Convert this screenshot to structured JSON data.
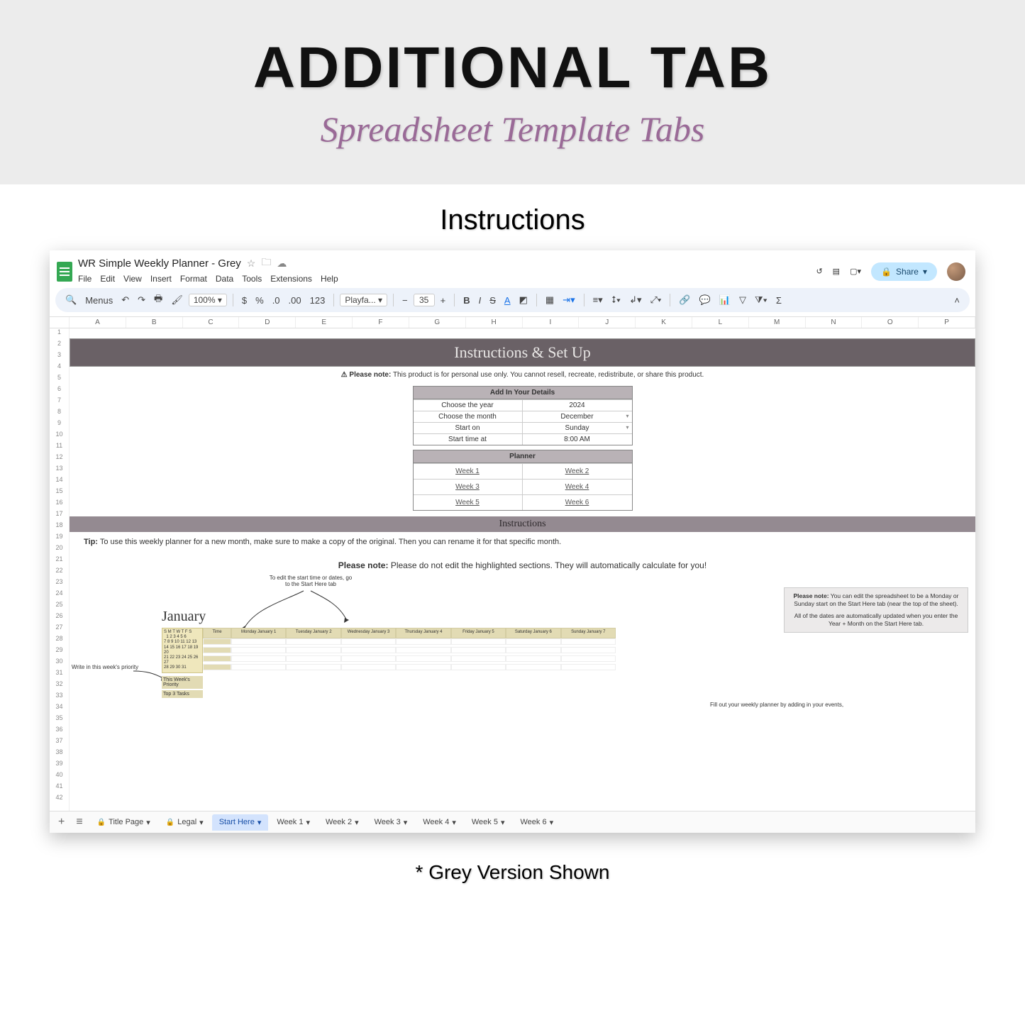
{
  "hero": {
    "title": "ADDITIONAL TAB",
    "subtitle": "Spreadsheet Template Tabs"
  },
  "section_label": "Instructions",
  "caption": "* Grey Version Shown",
  "doc": {
    "title": "WR Simple Weekly Planner - Grey",
    "menus": [
      "File",
      "Edit",
      "View",
      "Insert",
      "Format",
      "Data",
      "Tools",
      "Extensions",
      "Help"
    ],
    "share": "Share"
  },
  "toolbar": {
    "menus": "Menus",
    "zoom": "100%",
    "currency": "$",
    "percent": "%",
    "dec1": ".0",
    "dec2": ".00",
    "fmt": "123",
    "font": "Playfa...",
    "size": "35",
    "bold": "B",
    "italic": "I",
    "strike": "S",
    "underline": "A"
  },
  "columns": [
    "",
    "A",
    "B",
    "C",
    "D",
    "E",
    "F",
    "G",
    "H",
    "I",
    "J",
    "K",
    "L",
    "M",
    "N",
    "O",
    "P"
  ],
  "banner": "Instructions & Set Up",
  "please_note_label": "⚠ Please note:",
  "please_note": "This product is for personal use only. You cannot resell, recreate, redistribute, or share this product.",
  "details": {
    "header": "Add In Your Details",
    "rows": [
      {
        "label": "Choose the year",
        "value": "2024",
        "dd": false
      },
      {
        "label": "Choose the month",
        "value": "December",
        "dd": true
      },
      {
        "label": "Start on",
        "value": "Sunday",
        "dd": true
      },
      {
        "label": "Start time at",
        "value": "8:00 AM",
        "dd": false
      }
    ]
  },
  "planner": {
    "header": "Planner",
    "weeks": [
      [
        "Week 1",
        "Week 2"
      ],
      [
        "Week 3",
        "Week 4"
      ],
      [
        "Week 5",
        "Week 6"
      ]
    ]
  },
  "subbanner": "Instructions",
  "tip_label": "Tip:",
  "tip": "To use this weekly planner for a new month, make sure to make a copy of the original. Then you can rename it for that specific month.",
  "pnote_label": "Please note:",
  "pnote": "Please do not edit the highlighted sections. They will automatically calculate for you!",
  "callouts": {
    "edit_start": "To edit the start time or dates, go to the Start Here tab",
    "right_note_label": "Please note:",
    "right_note": "You can edit the spreadsheet to be a Monday or Sunday start on the Start Here tab (near the top of the sheet).",
    "right_note2": "All of the dates are automatically updated when you enter the Year + Month on the Start Here tab.",
    "priority_label": "Write in this week's priority",
    "fill": "Fill out your weekly planner by adding in your events,"
  },
  "jan": {
    "month": "January",
    "days": [
      "Monday January 1",
      "Tuesday January 2",
      "Wednesday January 3",
      "Thursday January 4",
      "Friday January 5",
      "Saturday January 6",
      "Sunday January 7"
    ],
    "priority": "This Week's Priority",
    "top": "Top 3 Tasks",
    "time": "Time"
  },
  "tabs": [
    {
      "label": "Title Page",
      "locked": true,
      "active": false
    },
    {
      "label": "Legal",
      "locked": true,
      "active": false
    },
    {
      "label": "Start Here",
      "locked": false,
      "active": true
    },
    {
      "label": "Week 1",
      "locked": false,
      "active": false
    },
    {
      "label": "Week 2",
      "locked": false,
      "active": false
    },
    {
      "label": "Week 3",
      "locked": false,
      "active": false
    },
    {
      "label": "Week 4",
      "locked": false,
      "active": false
    },
    {
      "label": "Week 5",
      "locked": false,
      "active": false
    },
    {
      "label": "Week 6",
      "locked": false,
      "active": false
    }
  ]
}
